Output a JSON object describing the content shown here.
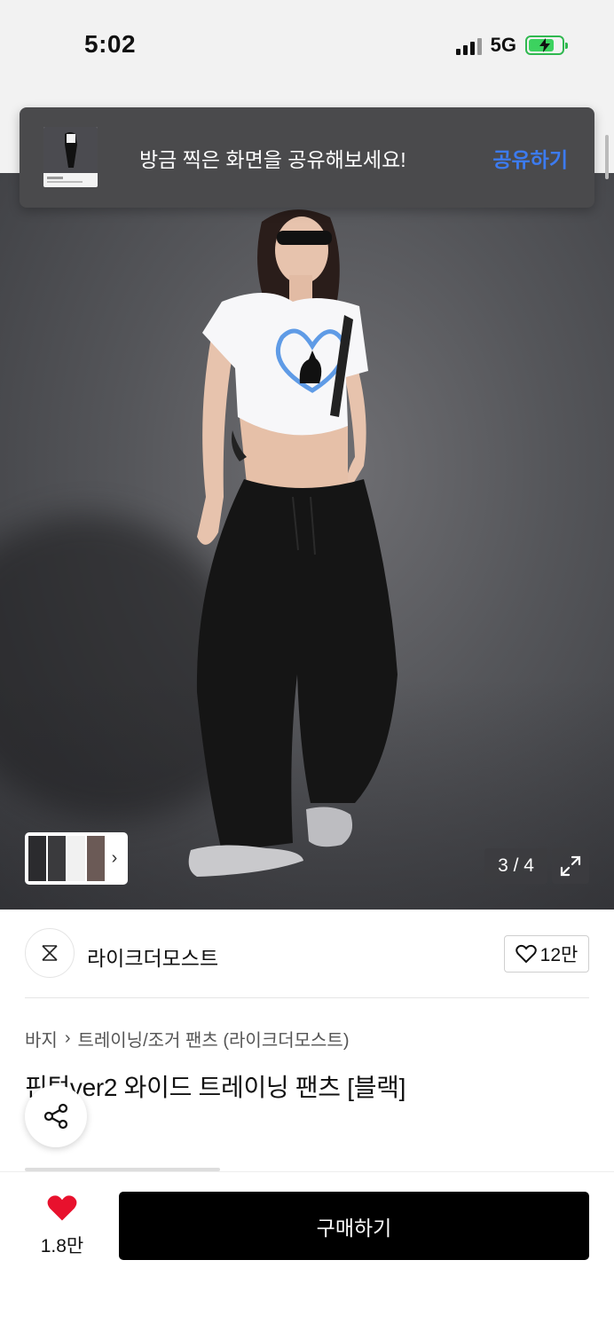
{
  "status_bar": {
    "time": "5:02",
    "network": "5G"
  },
  "toast": {
    "message": "방금 찍은 화면을 공유해보세요!",
    "action_label": "공유하기"
  },
  "gallery": {
    "counter": "3 / 4",
    "thumbnail_chevron": "›"
  },
  "brand": {
    "name": "라이크더모스트",
    "likes": "12만"
  },
  "breadcrumb": {
    "category": "바지",
    "separator": "›",
    "subcategory": "트레이닝/조거 팬츠 (라이크더모스트)"
  },
  "product": {
    "title": "핀턱ver2 와이드 트레이닝 팬츠 [블랙]"
  },
  "bottom_bar": {
    "wish_count": "1.8만",
    "buy_label": "구매하기"
  },
  "colors": {
    "accent_blue": "#3c7bf0",
    "heart_red": "#e8112d",
    "buy_button": "#000000"
  },
  "icons": [
    "signal-icon",
    "battery-charging-icon",
    "expand-icon",
    "heart-outline-icon",
    "share-icon",
    "heart-filled-icon",
    "chevron-right-icon"
  ]
}
